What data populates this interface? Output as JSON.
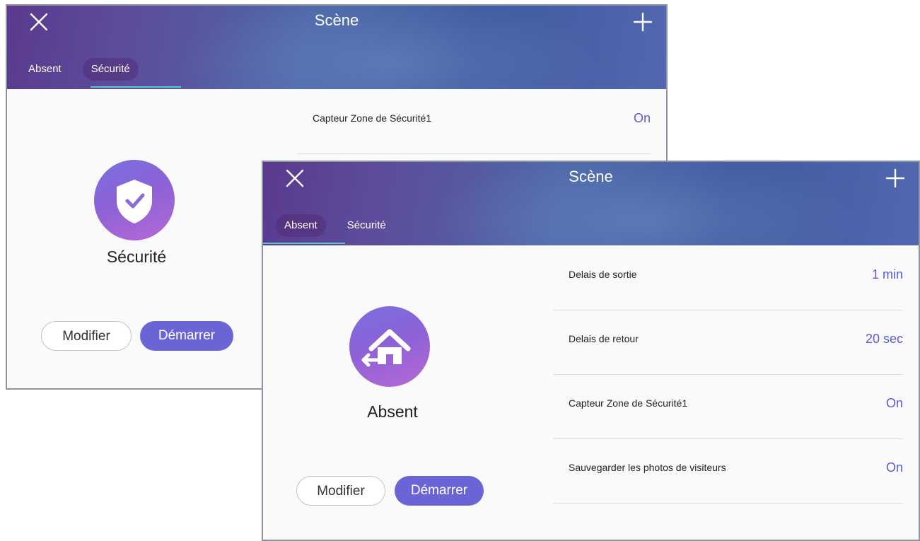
{
  "back_panel": {
    "header": {
      "title": "Scène",
      "close_icon": "close-icon",
      "add_icon": "plus-icon"
    },
    "tabs": [
      {
        "label": "Absent",
        "active": false
      },
      {
        "label": "Sécurité",
        "active": true
      }
    ],
    "scene": {
      "name": "Sécurité",
      "icon": "shield-check-icon"
    },
    "buttons": {
      "modify": "Modifier",
      "start": "Démarrer"
    },
    "settings": [
      {
        "label": "Capteur Zone de Sécurité1",
        "value": "On"
      }
    ]
  },
  "front_panel": {
    "header": {
      "title": "Scène",
      "close_icon": "close-icon",
      "add_icon": "plus-icon"
    },
    "tabs": [
      {
        "label": "Absent",
        "active": true
      },
      {
        "label": "Sécurité",
        "active": false
      }
    ],
    "scene": {
      "name": "Absent",
      "icon": "home-leave-icon"
    },
    "buttons": {
      "modify": "Modifier",
      "start": "Démarrer"
    },
    "settings": [
      {
        "label": "Delais de sortie",
        "value": "1 min"
      },
      {
        "label": "Delais de retour",
        "value": "20 sec"
      },
      {
        "label": "Capteur Zone de Sécurité1",
        "value": "On"
      },
      {
        "label": "Sauvegarder les photos de visiteurs",
        "value": "On"
      }
    ]
  },
  "colors": {
    "accent": "#6a64d6",
    "value_text": "#5b5bd6",
    "tab_underline": "#5cc7c7",
    "header_start": "#5a3a8e",
    "header_end": "#5267b0"
  }
}
